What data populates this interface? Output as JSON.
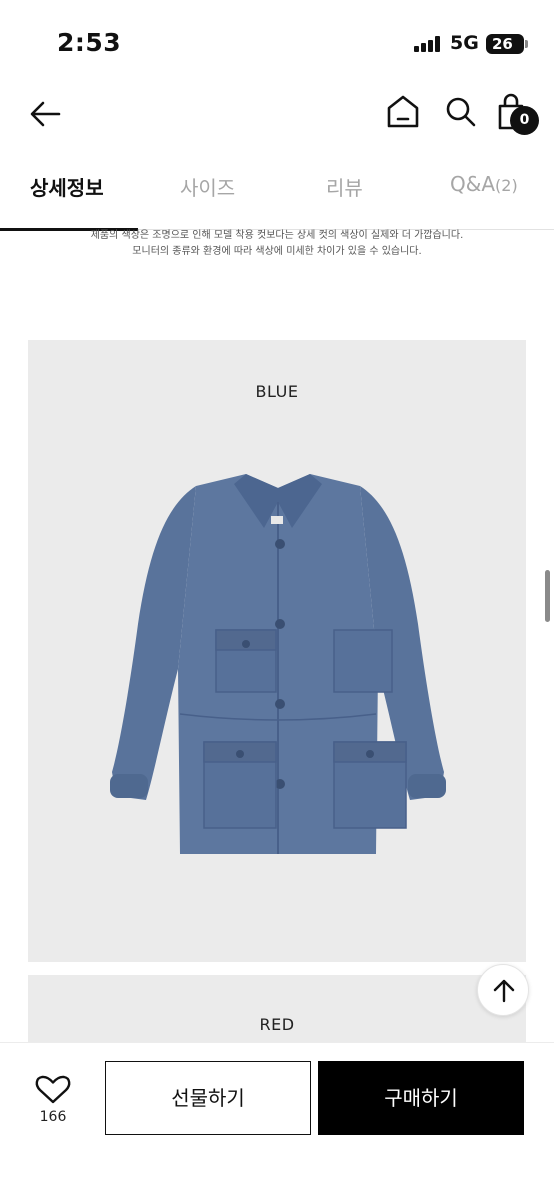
{
  "status_bar": {
    "time": "2:53",
    "network": "5G",
    "battery": "26"
  },
  "header": {
    "back_icon": "arrow-left-icon",
    "home_icon": "home-icon",
    "search_icon": "search-icon",
    "cart_icon": "shopping-bag-icon",
    "cart_count": "0"
  },
  "tabs": [
    {
      "label": "상세정보",
      "count": ""
    },
    {
      "label": "사이즈",
      "count": ""
    },
    {
      "label": "리뷰",
      "count": ""
    },
    {
      "label": "Q&A",
      "count": "(2)"
    }
  ],
  "notice": {
    "line1": "제품의 색상은 조명으로 인해 모델 착용 컷보다는 상세 컷의 색상이 실제와 더 가깝습니다.",
    "line2": "모니터의 종류와 환경에 따라 색상에 미세한 차이가 있을 수 있습니다."
  },
  "products": [
    {
      "color_name": "BLUE"
    },
    {
      "color_name": "RED"
    }
  ],
  "bottom_bar": {
    "like_count": "166",
    "gift_label": "선물하기",
    "buy_label": "구매하기"
  },
  "colors": {
    "jacket_blue": "#59739b",
    "panel_bg": "#ebebeb",
    "buy_bg": "#000000"
  }
}
